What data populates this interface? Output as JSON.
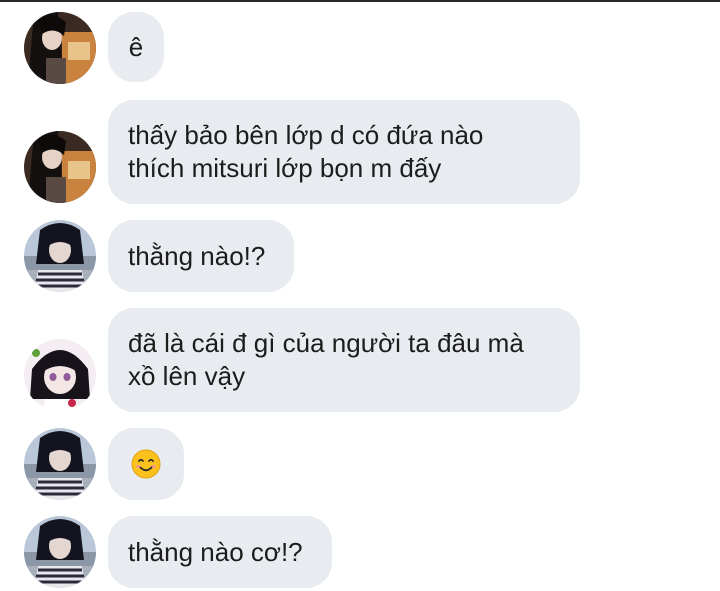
{
  "messages": [
    {
      "sender": "user-a",
      "lines": [
        "ê"
      ]
    },
    {
      "sender": "user-a",
      "lines": [
        "thấy bảo bên lớp d có đứa nào",
        "thích mitsuri lớp bọn m đấy"
      ]
    },
    {
      "sender": "user-b",
      "lines": [
        "thằng nào!?"
      ]
    },
    {
      "sender": "user-c",
      "lines": [
        "đã là cái đ gì của người ta đâu mà",
        "xồ lên vậy"
      ]
    },
    {
      "sender": "user-b",
      "emoji": "smiling-face-emoji",
      "lines": []
    },
    {
      "sender": "user-b",
      "lines": [
        "thằng nào cơ!?"
      ]
    }
  ],
  "colors": {
    "bubble": "#e8ebef",
    "text": "#1c1c1c",
    "background": "#ffffff"
  }
}
